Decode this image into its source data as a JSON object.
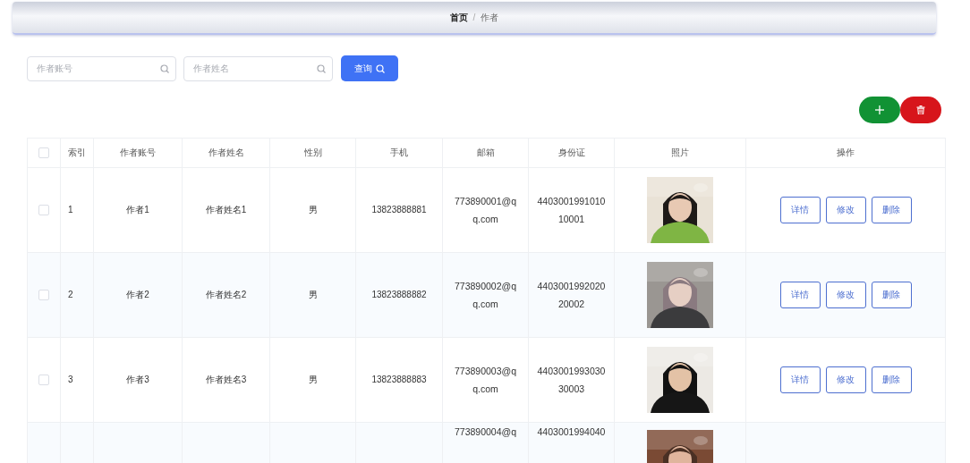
{
  "breadcrumb": {
    "separator": "/",
    "items": [
      {
        "label": "首页",
        "current": false
      },
      {
        "label": "作者",
        "current": true
      }
    ]
  },
  "search": {
    "fields": [
      {
        "placeholder": "作者账号"
      },
      {
        "placeholder": "作者姓名"
      }
    ],
    "button": "查询"
  },
  "table": {
    "header_checked": false,
    "columns": [
      "索引",
      "作者账号",
      "作者姓名",
      "性别",
      "手机",
      "邮箱",
      "身份证",
      "照片",
      "操作"
    ],
    "rows": [
      {
        "checked": false,
        "index": "1",
        "account": "作者1",
        "name": "作者姓名1",
        "gender": "男",
        "phone": "13823888881",
        "email": "773890001@qq.com",
        "id_card": "440300199101010001",
        "photo": {
          "kind": "picture"
        },
        "actions": [
          "详情",
          "修改",
          "删除"
        ]
      },
      {
        "checked": false,
        "index": "2",
        "account": "作者2",
        "name": "作者姓名2",
        "gender": "男",
        "phone": "13823888882",
        "email": "773890002@qq.com",
        "id_card": "440300199202020002",
        "photo": {
          "kind": "picture"
        },
        "actions": [
          "详情",
          "修改",
          "删除"
        ]
      },
      {
        "checked": false,
        "index": "3",
        "account": "作者3",
        "name": "作者姓名3",
        "gender": "男",
        "phone": "13823888883",
        "email": "773890003@qq.com",
        "id_card": "440300199303030003",
        "photo": {
          "kind": "picture"
        },
        "actions": [
          "详情",
          "修改",
          "删除"
        ]
      },
      {
        "email": "773890004@q",
        "id_card": "4403001994040",
        "photo": {
          "kind": "picture"
        }
      }
    ]
  }
}
